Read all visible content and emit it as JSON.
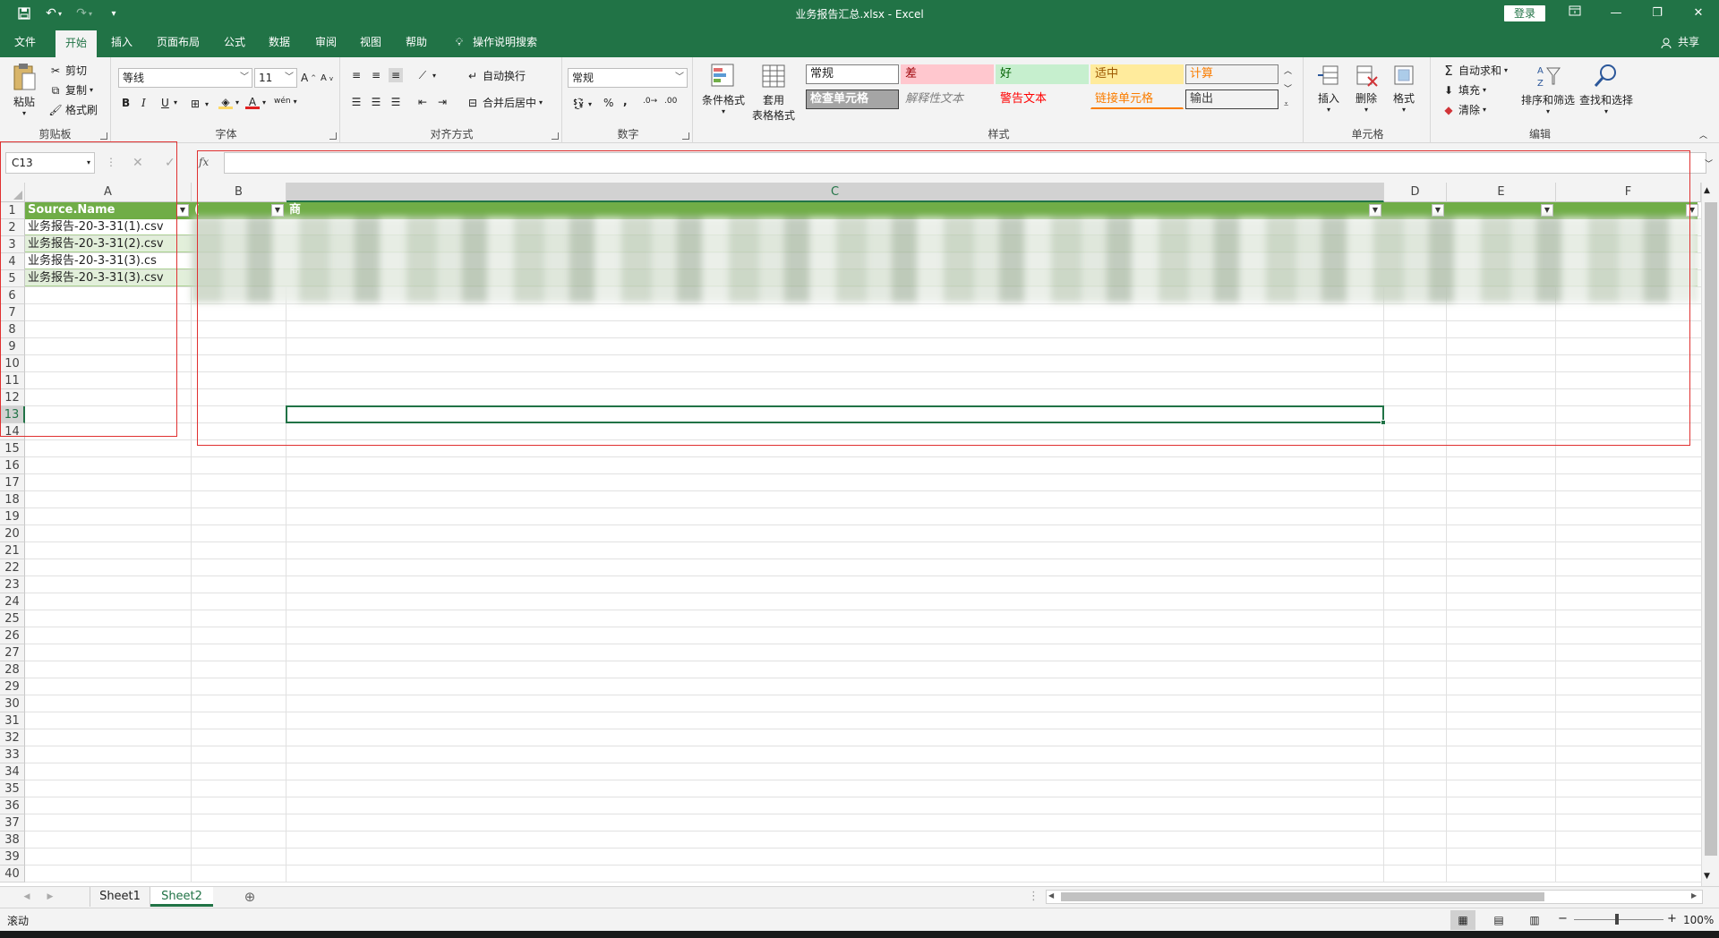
{
  "title_bar": {
    "document_title": "业务报告汇总.xlsx  -  Excel",
    "login_label": "登录",
    "qat_icons": [
      "save-icon",
      "undo-icon",
      "redo-icon",
      "customize-icon"
    ]
  },
  "ribbon_tabs": [
    "文件",
    "开始",
    "插入",
    "页面布局",
    "公式",
    "数据",
    "审阅",
    "视图",
    "帮助"
  ],
  "active_tab": "开始",
  "tell_me": "操作说明搜索",
  "share_label": "共享",
  "clipboard": {
    "paste": "粘贴",
    "cut": "剪切",
    "copy": "复制",
    "format_painter": "格式刷",
    "label": "剪贴板"
  },
  "font": {
    "name": "等线",
    "size": "11",
    "label": "字体",
    "bold": "B",
    "italic": "I",
    "underline": "U",
    "grow": "A",
    "shrink": "A",
    "font_color": "A",
    "phonetic": "wén"
  },
  "alignment": {
    "wrap": "自动换行",
    "merge": "合并后居中",
    "label": "对齐方式"
  },
  "number": {
    "format": "常规",
    "percent": "%",
    "comma": ",",
    "label": "数字"
  },
  "styles": {
    "conditional": "条件格式",
    "table_format_1": "套用",
    "table_format_2": "表格格式",
    "cells": [
      {
        "text": "常规",
        "bg": "#ffffff",
        "color": "#222222",
        "border": "#7f7f7f"
      },
      {
        "text": "差",
        "bg": "#ffc7ce",
        "color": "#9c0006",
        "border": "transparent"
      },
      {
        "text": "好",
        "bg": "#c6efce",
        "color": "#006100",
        "border": "transparent"
      },
      {
        "text": "适中",
        "bg": "#ffeb9c",
        "color": "#9c5700",
        "border": "transparent"
      },
      {
        "text": "计算",
        "bg": "#f2f2f2",
        "color": "#fa7d00",
        "border": "#7f7f7f"
      },
      {
        "text": "检查单元格",
        "bg": "#a5a5a5",
        "color": "#ffffff",
        "border": "#3f3f3f"
      },
      {
        "text": "解释性文本",
        "bg": "transparent",
        "color": "#7f7f7f",
        "border": "transparent"
      },
      {
        "text": "警告文本",
        "bg": "transparent",
        "color": "#ff0000",
        "border": "transparent"
      },
      {
        "text": "链接单元格",
        "bg": "transparent",
        "color": "#fa7d00",
        "border": "transparent"
      },
      {
        "text": "输出",
        "bg": "#f2f2f2",
        "color": "#3f3f3f",
        "border": "#3f3f3f"
      }
    ],
    "label": "样式"
  },
  "cells_group": {
    "insert": "插入",
    "delete": "删除",
    "format": "格式",
    "label": "单元格"
  },
  "editing": {
    "autosum": "自动求和",
    "fill": "填充",
    "clear": "清除",
    "sort": "排序和筛选",
    "find": "查找和选择",
    "label": "编辑"
  },
  "formula_bar": {
    "name_box": "C13",
    "fx": "fx",
    "value": ""
  },
  "columns": [
    "A",
    "B",
    "C",
    "D",
    "E",
    "F"
  ],
  "rows": [
    "1",
    "2",
    "3",
    "4",
    "5",
    "6",
    "7",
    "8",
    "9",
    "10",
    "11",
    "12",
    "13",
    "14",
    "15",
    "16",
    "17",
    "18",
    "19",
    "20",
    "21",
    "22",
    "23",
    "24",
    "25",
    "26",
    "27",
    "28",
    "29",
    "30",
    "31",
    "32",
    "33",
    "34",
    "35",
    "36",
    "37",
    "38",
    "39",
    "40"
  ],
  "header_row": {
    "A": "Source.Name",
    "B": "(",
    "C": "商"
  },
  "data_rows": [
    {
      "A": "业务报告-20-3-31(1).csv"
    },
    {
      "A": "业务报告-20-3-31(2).csv"
    },
    {
      "A": "业务报告-20-3-31(3).cs"
    },
    {
      "A": "业务报告-20-3-31(3).csv"
    }
  ],
  "sheets": [
    "Sheet1",
    "Sheet2"
  ],
  "active_sheet": "Sheet2",
  "status": {
    "mode": "滚动",
    "zoom": "100%"
  },
  "colors": {
    "excel_green": "#217346",
    "table_header": "#70ad47",
    "table_band": "#e2efda",
    "annotation": "#e03030"
  }
}
